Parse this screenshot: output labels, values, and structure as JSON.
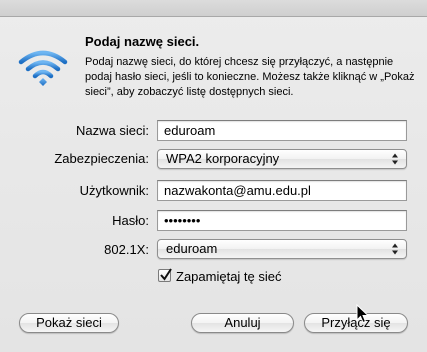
{
  "dialog": {
    "title": "Podaj nazwę sieci.",
    "description": "Podaj nazwę sieci, do której chcesz się przyłączyć, a następnie podaj hasło sieci, jeśli to konieczne. Możesz także kliknąć w „Pokaż sieci”, aby zobaczyć listę dostępnych sieci."
  },
  "form": {
    "network_name": {
      "label": "Nazwa sieci:",
      "value": "eduroam"
    },
    "security": {
      "label": "Zabezpieczenia:",
      "value": "WPA2 korporacyjny"
    },
    "username": {
      "label": "Użytkownik:",
      "value": "nazwakonta@amu.edu.pl"
    },
    "password": {
      "label": "Hasło:",
      "value": "••••••••"
    },
    "eap": {
      "label": "802.1X:",
      "value": "eduroam"
    },
    "remember": {
      "label": "Zapamiętaj tę sieć",
      "checked": true
    }
  },
  "buttons": {
    "show_networks": "Pokaż sieci",
    "cancel": "Anuluj",
    "join": "Przyłącz się"
  },
  "icons": {
    "wifi": "wifi-icon",
    "cursor": "mouse-pointer-icon",
    "checkmark": "checkmark-icon",
    "select_arrows": "up-down-arrows-icon"
  },
  "colors": {
    "wifi_blue": "#2f86d8",
    "window_bg": "#e8e8e8"
  }
}
